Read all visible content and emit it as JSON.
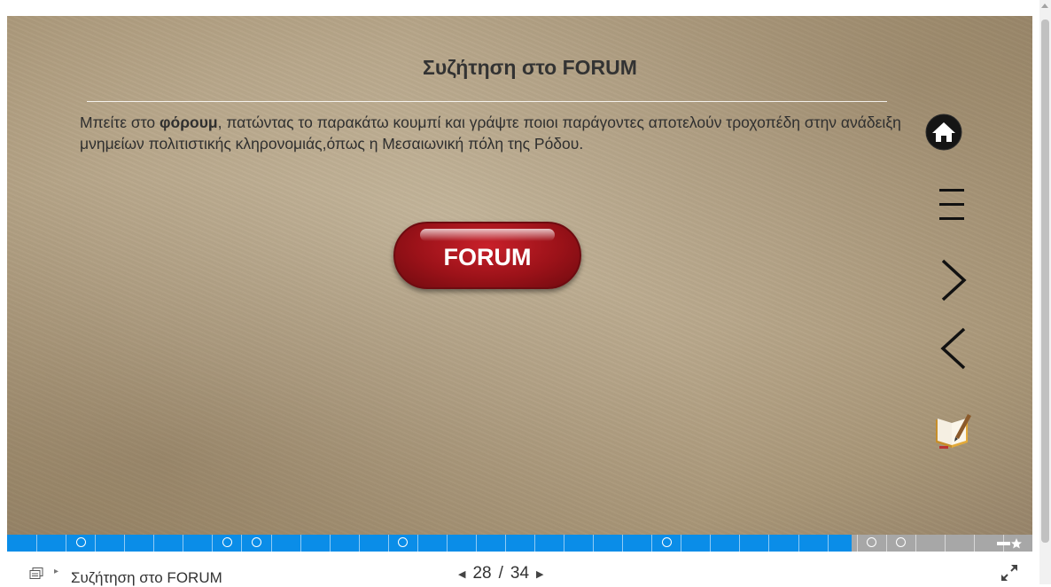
{
  "slide": {
    "title": "Συζήτηση στο FORUM",
    "body": {
      "part1": "Μπείτε στο ",
      "bold": "φόρουμ",
      "part2": ", πατώντας το παρακάτω κουμπί και γράψτε ποιοι παράγοντες αποτελούν τροχοπέδη στην ανάδειξη μνημείων πολιτιστικής κληρονομιάς,όπως η Μεσαιωνική πόλη της Ρόδου."
    },
    "forum_button_label": "FORUM"
  },
  "nav_buttons": [
    {
      "name": "home-icon"
    },
    {
      "name": "menu-icon"
    },
    {
      "name": "next-arrow-icon"
    },
    {
      "name": "previous-arrow-icon"
    },
    {
      "name": "notes-book-icon"
    }
  ],
  "progress": {
    "current": 28,
    "total": 34,
    "fraction": 0.8235,
    "fill_color": "#0a8de8",
    "rest_color": "#a7a7a7",
    "markers_at_slides": [
      3,
      8,
      9,
      14,
      23,
      30,
      31
    ]
  },
  "bottom_bar": {
    "breadcrumb": "Συζήτηση στο FORUM",
    "page_current": "28",
    "separator": "/",
    "page_total": "34"
  },
  "colors": {
    "forum_button": "#9c1219",
    "title_text": "#333333"
  }
}
